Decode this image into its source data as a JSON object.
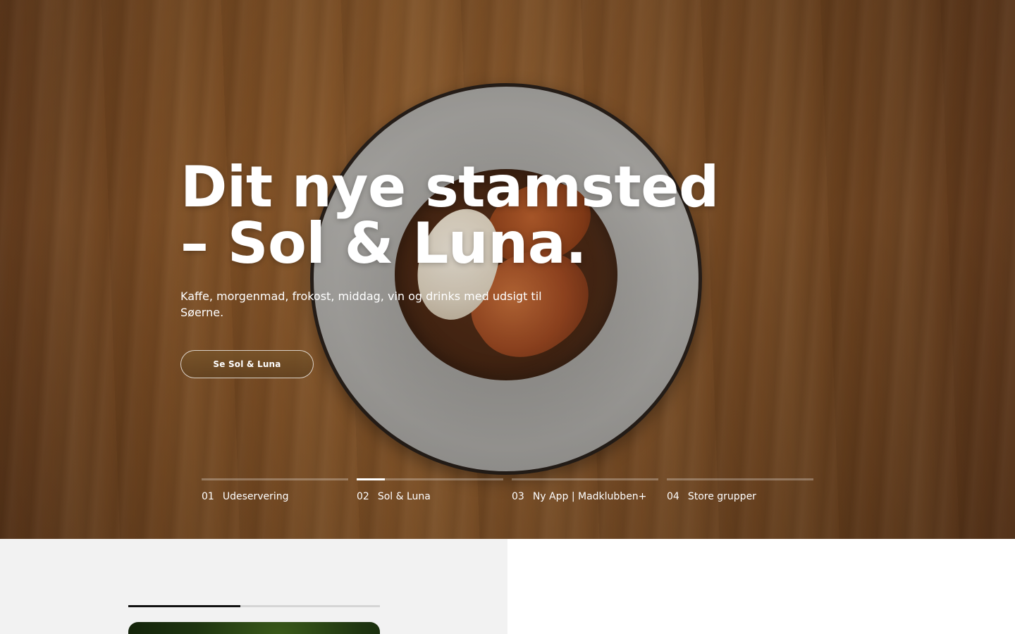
{
  "hero": {
    "title_line1": "Dit nye stamsted",
    "title_line2": "– Sol & Luna.",
    "subtitle": "Kaffe, morgenmad, frokost, middag, vin og drinks med udsigt til Søerne.",
    "cta_label": "Se Sol & Luna"
  },
  "slides": [
    {
      "number": "01",
      "label": "Udeservering",
      "progress": 0
    },
    {
      "number": "02",
      "label": "Sol & Luna",
      "progress": 0.19
    },
    {
      "number": "03",
      "label": "Ny App | Madklubben+",
      "progress": 0
    },
    {
      "number": "04",
      "label": "Store grupper",
      "progress": 0
    }
  ],
  "section": {
    "carousel_progress": 0.445
  },
  "colors": {
    "accent_button": "#6e4c26",
    "section_left_bg": "#f2f2f2",
    "progress_fill": "#111111"
  }
}
